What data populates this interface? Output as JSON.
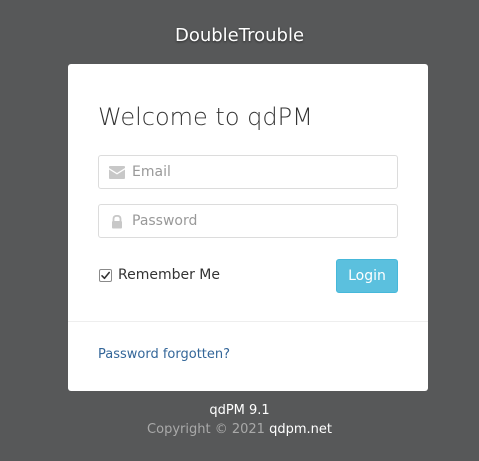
{
  "site": {
    "title": "DoubleTrouble"
  },
  "login": {
    "heading": "Welcome to qdPM",
    "email": {
      "placeholder": "Email",
      "value": "",
      "icon": "envelope-icon"
    },
    "password": {
      "placeholder": "Password",
      "value": "",
      "icon": "lock-icon"
    },
    "remember": {
      "label": "Remember Me",
      "checked": true
    },
    "submit_label": "Login",
    "forgot_label": "Password forgotten?"
  },
  "footer": {
    "version": "qdPM 9.1",
    "copyright_text": "Copyright © 2021",
    "copyright_link": "qdpm.net"
  },
  "colors": {
    "background": "#575859",
    "card": "#ffffff",
    "login_button": "#5bc0de",
    "link": "#336699"
  }
}
